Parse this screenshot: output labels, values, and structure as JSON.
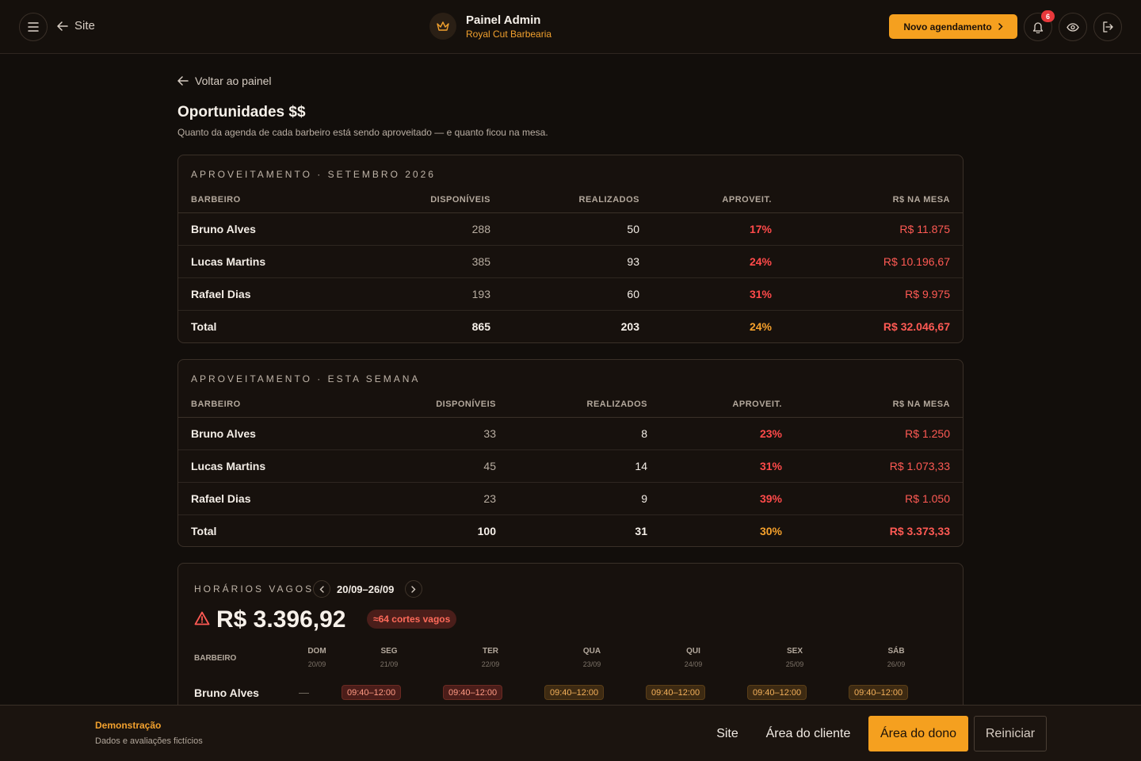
{
  "header": {
    "site_label": "Site",
    "brand_title": "Painel Admin",
    "brand_subtitle": "Royal Cut Barbearia",
    "new_button": "Novo agendamento",
    "notifications_count": "6",
    "icons": [
      "menu-icon",
      "arrow-left-icon",
      "crown-icon",
      "chevron-right-icon",
      "bell-icon",
      "eye-icon",
      "logout-icon"
    ]
  },
  "main": {
    "back_label": "Voltar ao painel",
    "title": "Oportunidades $$",
    "subtitle": "Quanto da agenda de cada barbeiro está sendo aproveitado — e quanto ficou na mesa."
  },
  "month_table": {
    "title": "APROVEITAMENTO · SETEMBRO 2026",
    "columns": [
      "BARBEIRO",
      "DISPONÍVEIS",
      "REALIZADOS",
      "APROVEIT.",
      "R$ NA MESA"
    ],
    "rows": [
      {
        "name": "Bruno Alves",
        "available": "288",
        "done": "50",
        "rate": "17%",
        "on_table": "R$ 11.875"
      },
      {
        "name": "Lucas Martins",
        "available": "385",
        "done": "93",
        "rate": "24%",
        "on_table": "R$ 10.196,67"
      },
      {
        "name": "Rafael Dias",
        "available": "193",
        "done": "60",
        "rate": "31%",
        "on_table": "R$ 9.975"
      }
    ],
    "total": {
      "name": "Total",
      "available": "865",
      "done": "203",
      "rate": "24%",
      "on_table": "R$ 32.046,67"
    }
  },
  "week_table": {
    "title": "APROVEITAMENTO · ESTA SEMANA",
    "columns": [
      "BARBEIRO",
      "DISPONÍVEIS",
      "REALIZADOS",
      "APROVEIT.",
      "R$ NA MESA"
    ],
    "rows": [
      {
        "name": "Bruno Alves",
        "available": "33",
        "done": "8",
        "rate": "23%",
        "on_table": "R$ 1.250"
      },
      {
        "name": "Lucas Martins",
        "available": "45",
        "done": "14",
        "rate": "31%",
        "on_table": "R$ 1.073,33"
      },
      {
        "name": "Rafael Dias",
        "available": "23",
        "done": "9",
        "rate": "39%",
        "on_table": "R$ 1.050"
      }
    ],
    "total": {
      "name": "Total",
      "available": "100",
      "done": "31",
      "rate": "30%",
      "on_table": "R$ 3.373,33"
    }
  },
  "vacancies": {
    "title": "HORÁRIOS VAGOS",
    "week_range": "20/09–26/09",
    "amount": "R$ 3.396,92",
    "cuts_badge": "≈64 cortes vagos",
    "barber_header": "BARBEIRO",
    "days": [
      {
        "name": "DOM",
        "date": "20/09"
      },
      {
        "name": "SEG",
        "date": "21/09"
      },
      {
        "name": "TER",
        "date": "22/09"
      },
      {
        "name": "QUA",
        "date": "23/09"
      },
      {
        "name": "QUI",
        "date": "24/09"
      },
      {
        "name": "SEX",
        "date": "25/09"
      },
      {
        "name": "SÁB",
        "date": "26/09"
      }
    ],
    "first_row": {
      "name": "Bruno Alves",
      "empty": "—",
      "slots": [
        "09:40–12:00",
        "09:40–12:00",
        "09:40–12:00",
        "09:40–12:00",
        "09:40–12:00",
        "09:40–12:00"
      ]
    }
  },
  "footer": {
    "demo_title": "Demonstração",
    "demo_subtitle": "Dados e avaliações fictícios",
    "site": "Site",
    "client_area": "Área do cliente",
    "owner_area": "Área do dono",
    "reset": "Reiniciar"
  },
  "colors": {
    "accent": "#f5a01f",
    "danger": "#ff4a4a",
    "background": "#120e0b"
  }
}
